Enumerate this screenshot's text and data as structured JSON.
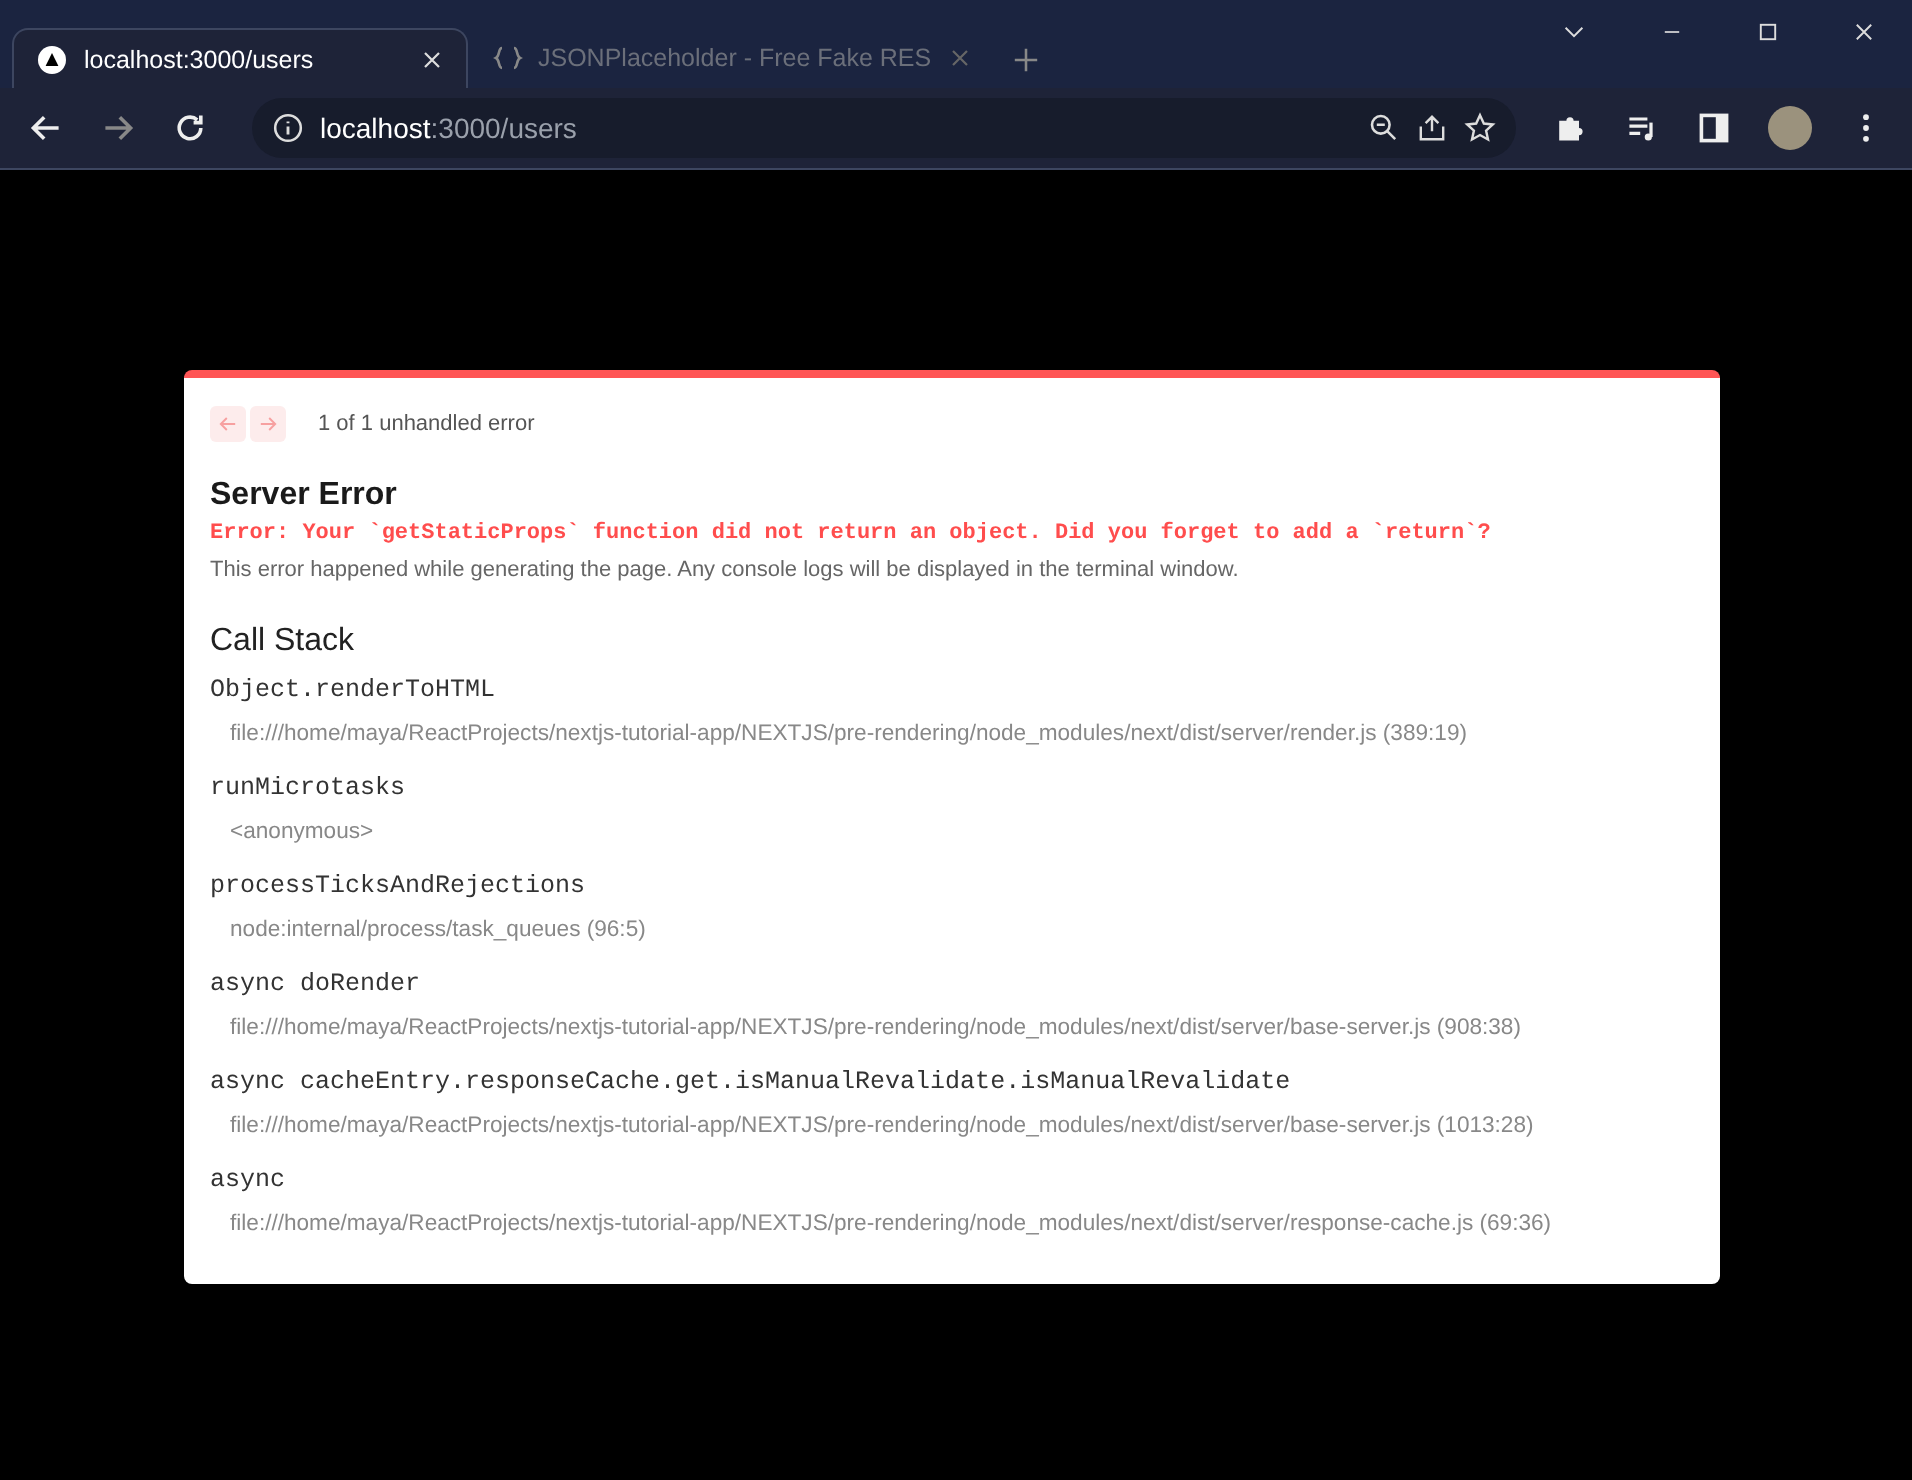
{
  "browser": {
    "tabs": [
      {
        "title": "localhost:3000/users",
        "selected": true
      },
      {
        "title": "JSONPlaceholder - Free Fake RES",
        "selected": false
      }
    ],
    "address": {
      "host": "localhost",
      "path": ":3000/users"
    }
  },
  "overlay": {
    "counter": "1 of 1 unhandled error",
    "title": "Server Error",
    "error": "Error: Your `getStaticProps` function did not return an object. Did you forget to add a `return`?",
    "note": "This error happened while generating the page. Any console logs will be displayed in the terminal window.",
    "stack_title": "Call Stack",
    "frames": [
      {
        "name": "Object.renderToHTML",
        "location": "file:///home/maya/ReactProjects/nextjs-tutorial-app/NEXTJS/pre-rendering/node_modules/next/dist/server/render.js (389:19)"
      },
      {
        "name": "runMicrotasks",
        "location": "<anonymous>"
      },
      {
        "name": "processTicksAndRejections",
        "location": "node:internal/process/task_queues (96:5)"
      },
      {
        "name": "async doRender",
        "location": "file:///home/maya/ReactProjects/nextjs-tutorial-app/NEXTJS/pre-rendering/node_modules/next/dist/server/base-server.js (908:38)"
      },
      {
        "name": "async cacheEntry.responseCache.get.isManualRevalidate.isManualRevalidate",
        "location": "file:///home/maya/ReactProjects/nextjs-tutorial-app/NEXTJS/pre-rendering/node_modules/next/dist/server/base-server.js (1013:28)"
      },
      {
        "name": "async",
        "location": "file:///home/maya/ReactProjects/nextjs-tutorial-app/NEXTJS/pre-rendering/node_modules/next/dist/server/response-cache.js (69:36)"
      }
    ]
  }
}
